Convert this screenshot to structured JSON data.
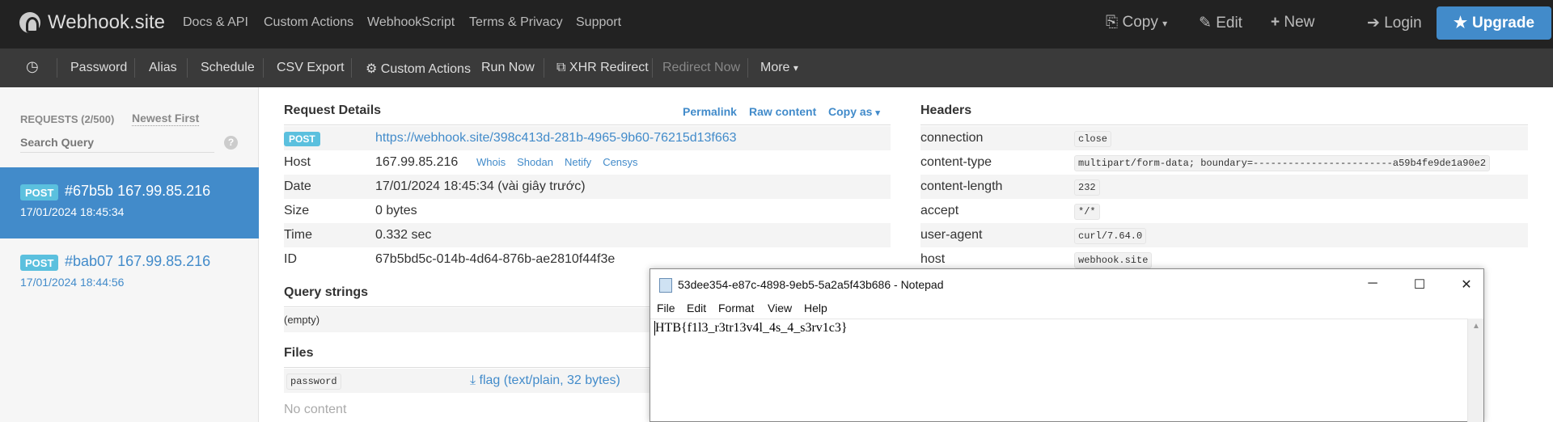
{
  "topbar": {
    "brand": "Webhook.site",
    "nav": [
      "Docs & API",
      "Custom Actions",
      "WebhookScript",
      "Terms & Privacy",
      "Support"
    ],
    "copy": "Copy",
    "edit": "Edit",
    "new": "New",
    "login": "Login",
    "upgrade": "Upgrade"
  },
  "toolbar": {
    "items": [
      "Password",
      "Alias",
      "Schedule",
      "CSV Export",
      "Custom Actions",
      "Run Now",
      "XHR Redirect",
      "Redirect Now",
      "More"
    ]
  },
  "sidebar": {
    "requests_label": "REQUESTS (2/500)",
    "sort_label": "Newest First",
    "search_placeholder": "Search Query",
    "help": "?",
    "items": [
      {
        "method": "POST",
        "title": "#67b5b 167.99.85.216",
        "time": "17/01/2024 18:45:34"
      },
      {
        "method": "POST",
        "title": "#bab07 167.99.85.216",
        "time": "17/01/2024 18:44:56"
      }
    ]
  },
  "details": {
    "heading": "Request Details",
    "permalink": "Permalink",
    "raw": "Raw content",
    "copy_as": "Copy as",
    "method": "POST",
    "url": "https://webhook.site/398c413d-281b-4965-9b60-76215d13f663",
    "rows": [
      {
        "key": "Host",
        "value": "167.99.85.216"
      },
      {
        "key": "Date",
        "value": "17/01/2024 18:45:34 (vài giây trước)"
      },
      {
        "key": "Size",
        "value": "0 bytes"
      },
      {
        "key": "Time",
        "value": "0.332 sec"
      },
      {
        "key": "ID",
        "value": "67b5bd5c-014b-4d64-876b-ae2810f44f3e"
      }
    ],
    "host_links": [
      "Whois",
      "Shodan",
      "Netify",
      "Censys"
    ],
    "query_heading": "Query strings",
    "query_value": "(empty)",
    "files_heading": "Files",
    "file_field": "password",
    "file_link": "flag (text/plain, 32 bytes)",
    "no_content": "No content"
  },
  "headers": {
    "heading": "Headers",
    "rows": [
      {
        "key": "connection",
        "value": "close"
      },
      {
        "key": "content-type",
        "value": "multipart/form-data; boundary=------------------------a59b4fe9de1a90e2"
      },
      {
        "key": "content-length",
        "value": "232"
      },
      {
        "key": "accept",
        "value": "*/*"
      },
      {
        "key": "user-agent",
        "value": "curl/7.64.0"
      },
      {
        "key": "host",
        "value": "webhook.site"
      }
    ]
  },
  "notepad": {
    "title": "53dee354-e87c-4898-9eb5-5a2a5f43b686 - Notepad",
    "menu": [
      "File",
      "Edit",
      "Format",
      "View",
      "Help"
    ],
    "content": "HTB{f1l3_r3tr13v4l_4s_4_s3rv1c3}"
  }
}
